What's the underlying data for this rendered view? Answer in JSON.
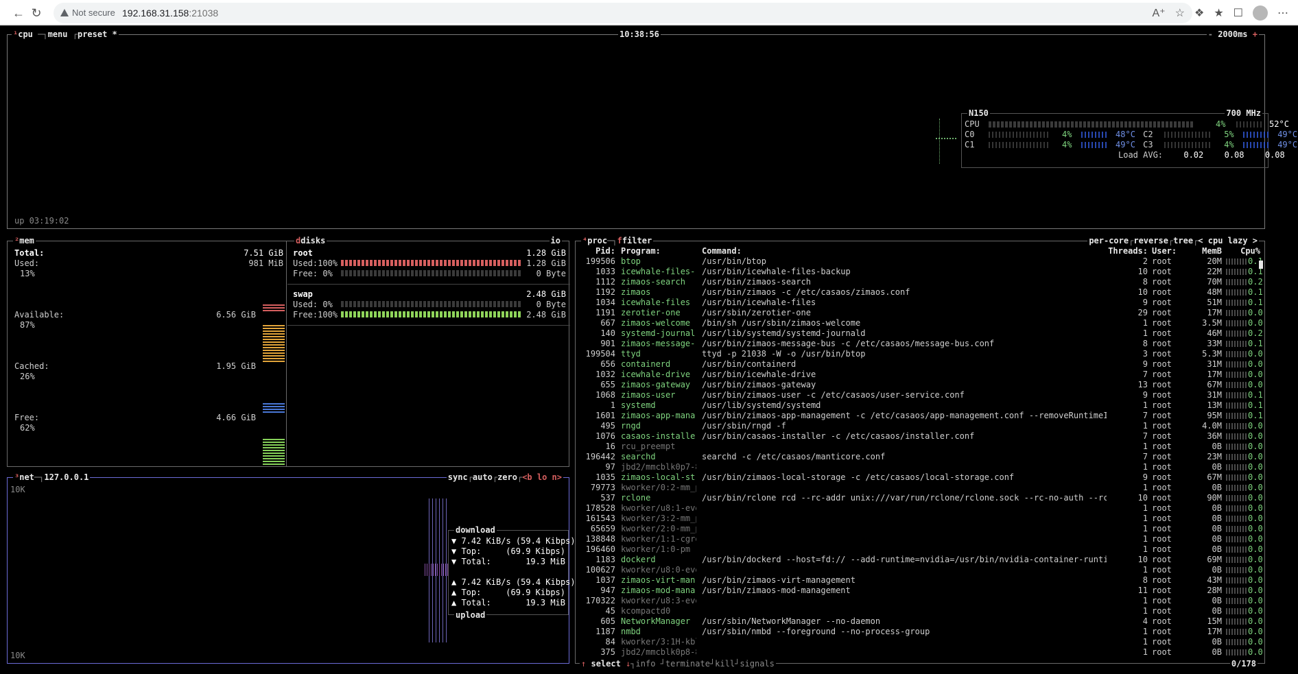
{
  "browser": {
    "security_label": "Not secure",
    "url_host": "192.168.31.158",
    "url_port": ":21038"
  },
  "cpu": {
    "tabs": [
      "cpu",
      "menu",
      "preset *"
    ],
    "clock": "10:38:56",
    "interval": "2000ms",
    "uptime": "up 03:19:02",
    "model": "N150",
    "freq": "700 MHz",
    "total": {
      "label": "CPU",
      "pct": "4%",
      "temp": "52°C"
    },
    "cores": [
      {
        "label": "C0",
        "pct": "4%",
        "temp": "48°C"
      },
      {
        "label": "C1",
        "pct": "4%",
        "temp": "49°C"
      },
      {
        "label": "C2",
        "pct": "5%",
        "temp": "49°C"
      },
      {
        "label": "C3",
        "pct": "4%",
        "temp": "49°C"
      }
    ],
    "load_label": "Load AVG:",
    "load": [
      "0.02",
      "0.08",
      "0.08"
    ]
  },
  "mem": {
    "title": "mem",
    "total_label": "Total:",
    "total": "7.51 GiB",
    "used_label": "Used:",
    "used": "981 MiB",
    "used_pct": "13%",
    "avail_label": "Available:",
    "avail": "6.56 GiB",
    "avail_pct": "87%",
    "cached_label": "Cached:",
    "cached": "1.95 GiB",
    "cached_pct": "26%",
    "free_label": "Free:",
    "free": "4.66 GiB",
    "free_pct": "62%"
  },
  "disks": {
    "title": "disks",
    "io_label": "io",
    "root": {
      "name": "root",
      "size": "1.28 GiB",
      "used_label": "Used:100%",
      "used": "1.28 GiB",
      "free_label": "Free:  0%",
      "free": "0 Byte"
    },
    "swap": {
      "name": "swap",
      "size": "2.48 GiB",
      "used_label": "Used:  0%",
      "used": "0 Byte",
      "free_label": "Free:100%",
      "free": "2.48 GiB"
    }
  },
  "net": {
    "title": "net",
    "iface": "127.0.0.1",
    "opts": [
      "sync",
      "auto",
      "zero",
      "<b lo n>"
    ],
    "scale_top": "10K",
    "scale_bottom": "10K",
    "download_label": "download",
    "upload_label": "upload",
    "down_rate": "▼ 7.42 KiB/s (59.4 Kibps)",
    "down_top_label": "▼ Top:",
    "down_top": "(69.9 Kibps)",
    "down_total_label": "▼ Total:",
    "down_total": "19.3 MiB",
    "up_rate": "▲ 7.42 KiB/s (59.4 Kibps)",
    "up_top_label": "▲ Top:",
    "up_top": "(69.9 Kibps)",
    "up_total_label": "▲ Total:",
    "up_total": "19.3 MiB"
  },
  "proc": {
    "tabs": [
      "proc",
      "filter"
    ],
    "opts": [
      "per-core",
      "reverse",
      "tree",
      "< cpu lazy >"
    ],
    "headers": {
      "pid": "Pid:",
      "program": "Program:",
      "command": "Command:",
      "threads": "Threads:",
      "user": "User:",
      "mem": "MemB",
      "cpu": "Cpu%"
    },
    "rows": [
      [
        "199506",
        "btop",
        "/usr/bin/btop",
        "2",
        "root",
        "20M",
        "0.1"
      ],
      [
        "1033",
        "icewhale-files-",
        "/usr/bin/icewhale-files-backup",
        "10",
        "root",
        "22M",
        "0.1"
      ],
      [
        "1112",
        "zimaos-search",
        "/usr/bin/zimaos-search",
        "8",
        "root",
        "70M",
        "0.2"
      ],
      [
        "1192",
        "zimaos",
        "/usr/bin/zimaos -c /etc/casaos/zimaos.conf",
        "10",
        "root",
        "48M",
        "0.1"
      ],
      [
        "1034",
        "icewhale-files",
        "/usr/bin/icewhale-files",
        "9",
        "root",
        "51M",
        "0.1"
      ],
      [
        "1191",
        "zerotier-one",
        "/usr/sbin/zerotier-one",
        "29",
        "root",
        "17M",
        "0.0"
      ],
      [
        "667",
        "zimaos-welcome",
        "/bin/sh /usr/sbin/zimaos-welcome",
        "1",
        "root",
        "3.5M",
        "0.0"
      ],
      [
        "140",
        "systemd-journal",
        "/usr/lib/systemd/systemd-journald",
        "1",
        "root",
        "46M",
        "0.2"
      ],
      [
        "901",
        "zimaos-message-",
        "/usr/bin/zimaos-message-bus -c /etc/casaos/message-bus.conf",
        "8",
        "root",
        "33M",
        "0.1"
      ],
      [
        "199504",
        "ttyd",
        "ttyd -p 21038 -W -o /usr/bin/btop",
        "3",
        "root",
        "5.3M",
        "0.0"
      ],
      [
        "656",
        "containerd",
        "/usr/bin/containerd",
        "9",
        "root",
        "31M",
        "0.0"
      ],
      [
        "1032",
        "icewhale-drive",
        "/usr/bin/icewhale-drive",
        "7",
        "root",
        "17M",
        "0.0"
      ],
      [
        "655",
        "zimaos-gateway",
        "/usr/bin/zimaos-gateway",
        "13",
        "root",
        "67M",
        "0.0"
      ],
      [
        "1068",
        "zimaos-user",
        "/usr/bin/zimaos-user -c /etc/casaos/user-service.conf",
        "9",
        "root",
        "31M",
        "0.1"
      ],
      [
        "1",
        "systemd",
        "/usr/lib/systemd/systemd",
        "1",
        "root",
        "13M",
        "0.1"
      ],
      [
        "1601",
        "zimaos-app-mana",
        "/usr/bin/zimaos-app-management -c /etc/casaos/app-management.conf --removeRuntimeI",
        "7",
        "root",
        "95M",
        "0.1"
      ],
      [
        "495",
        "rngd",
        "/usr/sbin/rngd -f",
        "1",
        "root",
        "4.0M",
        "0.0"
      ],
      [
        "1076",
        "casaos-installe",
        "/usr/bin/casaos-installer -c /etc/casaos/installer.conf",
        "7",
        "root",
        "36M",
        "0.0"
      ],
      [
        "16",
        "rcu_preempt",
        "",
        "1",
        "root",
        "0B",
        "0.0"
      ],
      [
        "196442",
        "searchd",
        "searchd -c /etc/casaos/manticore.conf",
        "7",
        "root",
        "23M",
        "0.0"
      ],
      [
        "97",
        "jbd2/mmcblk0p7-8",
        "",
        "1",
        "root",
        "0B",
        "0.0"
      ],
      [
        "1035",
        "zimaos-local-st",
        "/usr/bin/zimaos-local-storage -c /etc/casaos/local-storage.conf",
        "9",
        "root",
        "67M",
        "0.0"
      ],
      [
        "79773",
        "kworker/0:2-mm_p",
        "",
        "1",
        "root",
        "0B",
        "0.0"
      ],
      [
        "537",
        "rclone",
        "/usr/bin/rclone rcd --rc-addr unix:///var/run/rclone/rclone.sock --rc-no-auth --rc",
        "10",
        "root",
        "90M",
        "0.0"
      ],
      [
        "178528",
        "kworker/u8:1-eve",
        "",
        "1",
        "root",
        "0B",
        "0.0"
      ],
      [
        "161543",
        "kworker/3:2-mm_p",
        "",
        "1",
        "root",
        "0B",
        "0.0"
      ],
      [
        "65659",
        "kworker/2:0-mm_p",
        "",
        "1",
        "root",
        "0B",
        "0.0"
      ],
      [
        "138848",
        "kworker/1:1-cgro",
        "",
        "1",
        "root",
        "0B",
        "0.0"
      ],
      [
        "196460",
        "kworker/1:0-pm",
        "",
        "1",
        "root",
        "0B",
        "0.0"
      ],
      [
        "1183",
        "dockerd",
        "/usr/bin/dockerd --host=fd:// --add-runtime=nvidia=/usr/bin/nvidia-container-runti",
        "10",
        "root",
        "69M",
        "0.0"
      ],
      [
        "100627",
        "kworker/u8:0-eve",
        "",
        "1",
        "root",
        "0B",
        "0.0"
      ],
      [
        "1037",
        "zimaos-virt-man",
        "/usr/bin/zimaos-virt-management",
        "8",
        "root",
        "43M",
        "0.0"
      ],
      [
        "947",
        "zimaos-mod-mana",
        "/usr/bin/zimaos-mod-management",
        "11",
        "root",
        "28M",
        "0.0"
      ],
      [
        "170322",
        "kworker/u8:3-eve",
        "",
        "1",
        "root",
        "0B",
        "0.0"
      ],
      [
        "45",
        "kcompactd0",
        "",
        "1",
        "root",
        "0B",
        "0.0"
      ],
      [
        "605",
        "NetworkManager",
        "/usr/sbin/NetworkManager --no-daemon",
        "4",
        "root",
        "15M",
        "0.0"
      ],
      [
        "1187",
        "nmbd",
        "/usr/sbin/nmbd --foreground --no-process-group",
        "1",
        "root",
        "17M",
        "0.0"
      ],
      [
        "84",
        "kworker/3:1H-kbl",
        "",
        "1",
        "root",
        "0B",
        "0.0"
      ],
      [
        "375",
        "jbd2/mmcblk0p8-8",
        "",
        "1",
        "root",
        "0B",
        "0.0"
      ]
    ],
    "footer": {
      "select": "select",
      "info": "info",
      "terminate": "terminate",
      "kill": "kill",
      "signals": "signals"
    },
    "count": "0/178"
  }
}
